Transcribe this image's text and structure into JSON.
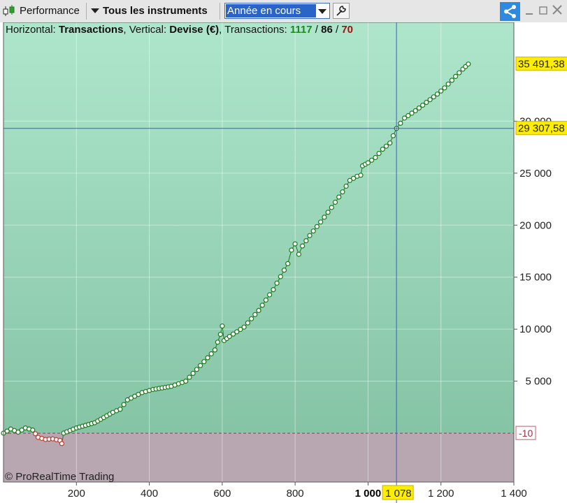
{
  "toolbar": {
    "performance_label": "Performance",
    "instruments_label": "Tous les instruments",
    "period_value": "Année en cours"
  },
  "header": {
    "horizontal_prefix": "Horizontal: ",
    "horizontal_value": "Transactions",
    "vertical_prefix": ", Vertical: ",
    "vertical_value": "Devise (€)",
    "transactions_prefix": ", Transactions: ",
    "transactions_total": "1117",
    "sep1": " / ",
    "transactions_second": "86",
    "sep2": " / ",
    "transactions_third": "70"
  },
  "watermark": "© ProRealTime Trading",
  "colors": {
    "gain_region_top": "#aee6cc",
    "gain_region_bottom": "#86c4a6",
    "loss_region": "#b8a6b0",
    "line": "#1a7a1a",
    "marker_win_stroke": "#1a7a1a",
    "marker_loss_stroke": "#c0392b",
    "crosshair": "#3c5ad8",
    "label_highlight": "#ffee00",
    "total_green": "#1a8a1a",
    "third_red": "#a01010"
  },
  "chart_data": {
    "type": "line",
    "xlabel": "",
    "ylabel": "",
    "xlim": [
      0,
      1400
    ],
    "ylim": [
      -4700,
      39500
    ],
    "x_ticks": [
      200,
      400,
      600,
      800,
      1000,
      1200,
      1400
    ],
    "x_tick_labels": [
      "200",
      "400",
      "600",
      "800",
      "1 000",
      "1 200",
      "1 400"
    ],
    "y_ticks": [
      5000,
      10000,
      15000,
      20000,
      25000,
      30000
    ],
    "y_tick_labels": [
      "5 000",
      "10 000",
      "15 000",
      "20 000",
      "25 000",
      "30 000"
    ],
    "grid": true,
    "baseline": -10,
    "baseline_label": "-10",
    "last_value": 35491.38,
    "last_value_label": "35 491,38",
    "crosshair": {
      "x": 1078,
      "x_label": "1 078",
      "y": 29307.58,
      "y_label": "29 307,58"
    },
    "series": [
      {
        "values": [
          [
            0,
            0
          ],
          [
            20,
            400
          ],
          [
            40,
            100
          ],
          [
            60,
            500
          ],
          [
            80,
            300
          ],
          [
            95,
            -400
          ],
          [
            115,
            -600
          ],
          [
            135,
            -550
          ],
          [
            155,
            -700
          ],
          [
            160,
            -1000
          ],
          [
            165,
            0
          ],
          [
            200,
            500
          ],
          [
            250,
            1000
          ],
          [
            300,
            2000
          ],
          [
            320,
            2300
          ],
          [
            340,
            3200
          ],
          [
            380,
            3900
          ],
          [
            410,
            4200
          ],
          [
            460,
            4500
          ],
          [
            500,
            5000
          ],
          [
            540,
            6500
          ],
          [
            580,
            8000
          ],
          [
            595,
            9500
          ],
          [
            600,
            10300
          ],
          [
            605,
            8900
          ],
          [
            620,
            9300
          ],
          [
            660,
            10200
          ],
          [
            700,
            11800
          ],
          [
            740,
            13800
          ],
          [
            780,
            16300
          ],
          [
            790,
            17600
          ],
          [
            800,
            18200
          ],
          [
            810,
            17200
          ],
          [
            820,
            18000
          ],
          [
            840,
            19000
          ],
          [
            870,
            20300
          ],
          [
            900,
            21700
          ],
          [
            930,
            23200
          ],
          [
            950,
            24300
          ],
          [
            970,
            24700
          ],
          [
            980,
            24800
          ],
          [
            985,
            25700
          ],
          [
            1000,
            26000
          ],
          [
            1020,
            26500
          ],
          [
            1040,
            27300
          ],
          [
            1060,
            27900
          ],
          [
            1078,
            29300
          ],
          [
            1100,
            30300
          ],
          [
            1130,
            31000
          ],
          [
            1160,
            31800
          ],
          [
            1190,
            32600
          ],
          [
            1210,
            33200
          ],
          [
            1240,
            34300
          ],
          [
            1260,
            35000
          ],
          [
            1275,
            35491.38
          ]
        ]
      }
    ]
  }
}
